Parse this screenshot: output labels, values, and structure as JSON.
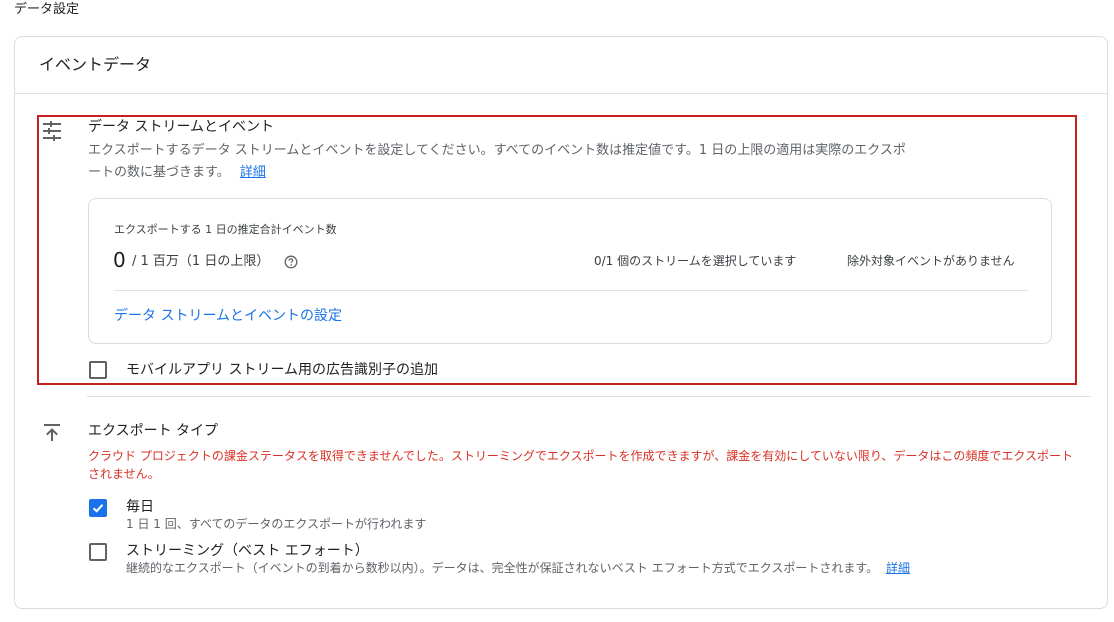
{
  "page": {
    "title": "データ設定"
  },
  "card": {
    "title": "イベントデータ"
  },
  "streams_section": {
    "icon": "tune-sliders-icon",
    "title": "データ ストリームとイベント",
    "description_line1": "エクスポートするデータ ストリームとイベントを設定してください。すべてのイベント数は推定値です。1 日の上限の適用は実際のエクスポ",
    "description_line2": "ートの数に基づきます。",
    "details_link": "詳細",
    "estimate": {
      "label": "エクスポートする 1 日の推定合計イベント数",
      "count": "0",
      "limit": "/ 1 百万（1 日の上限）",
      "help_icon": "help-circle-icon",
      "streams_selected": "0/1 個のストリームを選択しています",
      "excluded_events": "除外対象イベントがありません",
      "config_link": "データ ストリームとイベントの設定"
    },
    "ad_id_checkbox": {
      "label": "モバイルアプリ ストリーム用の広告識別子の追加",
      "checked": false
    }
  },
  "export_type_section": {
    "icon": "upload-icon",
    "title": "エクスポート タイプ",
    "error": "クラウド プロジェクトの課金ステータスを取得できませんでした。ストリーミングでエクスポートを作成できますが、課金を有効にしていない限り、データはこの頻度でエクスポートされません。",
    "daily": {
      "label": "毎日",
      "description": "1 日 1 回、すべてのデータのエクスポートが行われます",
      "checked": true
    },
    "streaming": {
      "label": "ストリーミング（ベスト エフォート）",
      "description": "継続的なエクスポート（イベントの到着から数秒以内）。データは、完全性が保証されないベスト エフォート方式でエクスポートされます。",
      "details_link": "詳細",
      "checked": false
    }
  },
  "colors": {
    "accent": "#1a73e8",
    "error": "#d93025",
    "highlight_border": "#c5221f"
  }
}
